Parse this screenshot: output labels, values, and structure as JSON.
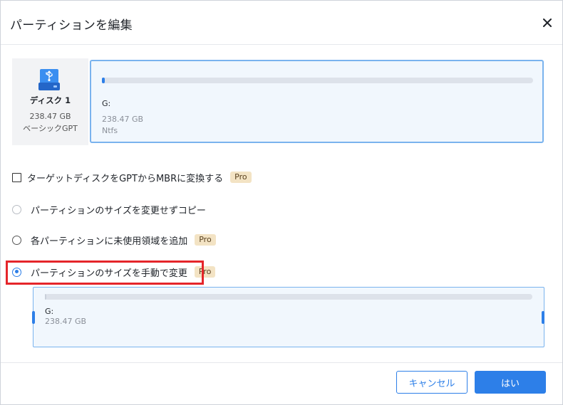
{
  "dialog": {
    "title": "パーティションを編集"
  },
  "disk": {
    "name": "ディスク 1",
    "size": "238.47 GB",
    "type": "ベーシックGPT"
  },
  "partition": {
    "letter": "G:",
    "size": "238.47 GB",
    "filesystem": "Ntfs",
    "used_fraction": 0.004
  },
  "options": {
    "convert_gpt_mbr": {
      "label": "ターゲットディスクをGPTからMBRに変換する",
      "badge": "Pro",
      "checked": false
    },
    "copy_no_resize": {
      "label": "パーティションのサイズを変更せずコピー",
      "disabled": true
    },
    "add_unused_space": {
      "label": "各パーティションに未使用領域を追加",
      "badge": "Pro"
    },
    "manual_resize": {
      "label": "パーティションのサイズを手動で変更",
      "badge": "Pro",
      "selected": true
    }
  },
  "resize": {
    "letter": "G:",
    "size": "238.47 GB"
  },
  "buttons": {
    "cancel": "キャンセル",
    "ok": "はい"
  },
  "colors": {
    "accent": "#2d7fe8",
    "highlight": "#e5252a",
    "pro_badge": "#f3e3c4"
  }
}
